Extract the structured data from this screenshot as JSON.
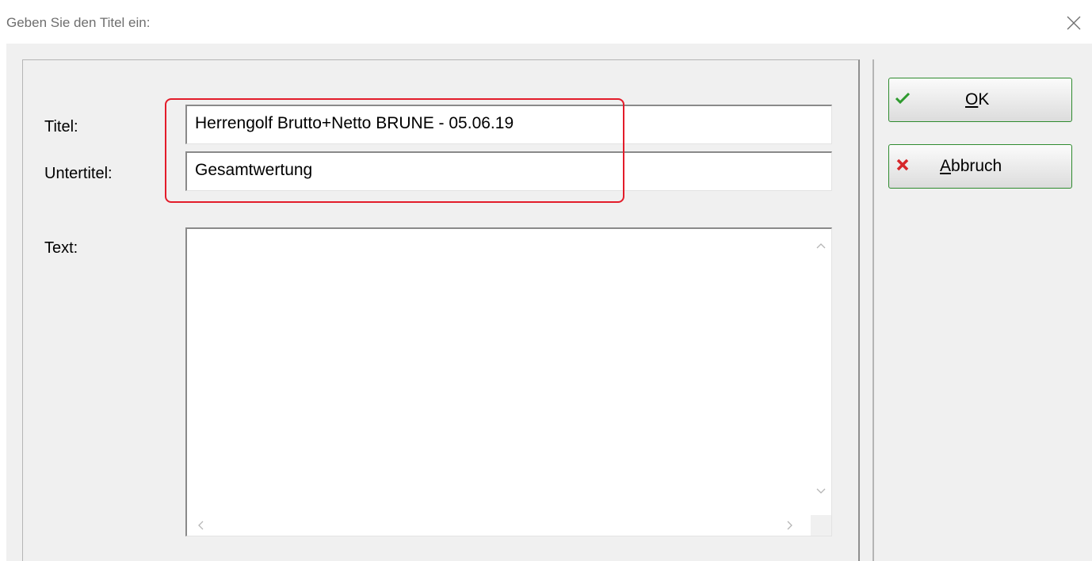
{
  "window": {
    "title": "Geben Sie den Titel ein:"
  },
  "form": {
    "title_label": "Titel:",
    "title_value": "Herrengolf Brutto+Netto BRUNE - 05.06.19",
    "subtitle_label": "Untertitel:",
    "subtitle_value": "Gesamtwertung",
    "text_label": "Text:",
    "text_value": ""
  },
  "buttons": {
    "ok": {
      "mnemonic": "O",
      "rest": "K"
    },
    "cancel": {
      "mnemonic": "A",
      "rest": "bbruch"
    }
  },
  "icons": {
    "close": "close-icon",
    "ok": "checkmark-icon",
    "cancel": "x-mark-icon"
  },
  "colors": {
    "highlight": "#e31c2a",
    "ok_check": "#2e9a2e",
    "cancel_x": "#d6262a"
  }
}
